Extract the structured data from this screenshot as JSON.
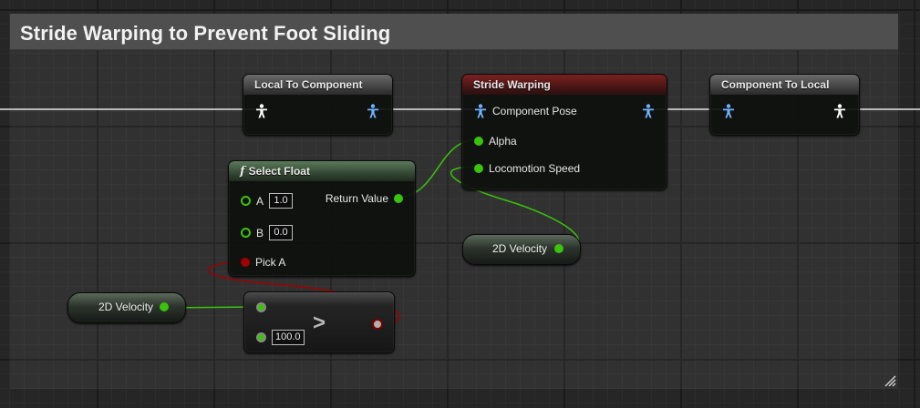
{
  "comment": {
    "title": "Stride Warping to Prevent Foot Sliding"
  },
  "local_to_component": {
    "title": "Local To Component"
  },
  "stride_warping": {
    "title": "Stride Warping",
    "pins": {
      "component_pose": "Component Pose",
      "alpha": "Alpha",
      "locomotion_speed": "Locomotion Speed"
    }
  },
  "component_to_local": {
    "title": "Component To Local"
  },
  "select_float": {
    "title": "Select Float",
    "function_icon": "f",
    "pins": {
      "a_label": "A",
      "a_value": "1.0",
      "b_label": "B",
      "b_value": "0.0",
      "pick_a": "Pick A",
      "return_value": "Return Value"
    }
  },
  "velocity_var_top": {
    "label": "2D Velocity"
  },
  "velocity_var_bottom": {
    "label": "2D Velocity"
  },
  "greater_node": {
    "operator": ">",
    "b_value": "100.0"
  },
  "icons": {
    "pose_pin": "pose-person-icon",
    "function": "function-icon"
  },
  "colors": {
    "float_pin": "#39c30a",
    "bool_pin": "#a00000",
    "pose_out": "#ffffff",
    "pose_in": "#6fb2ff"
  }
}
